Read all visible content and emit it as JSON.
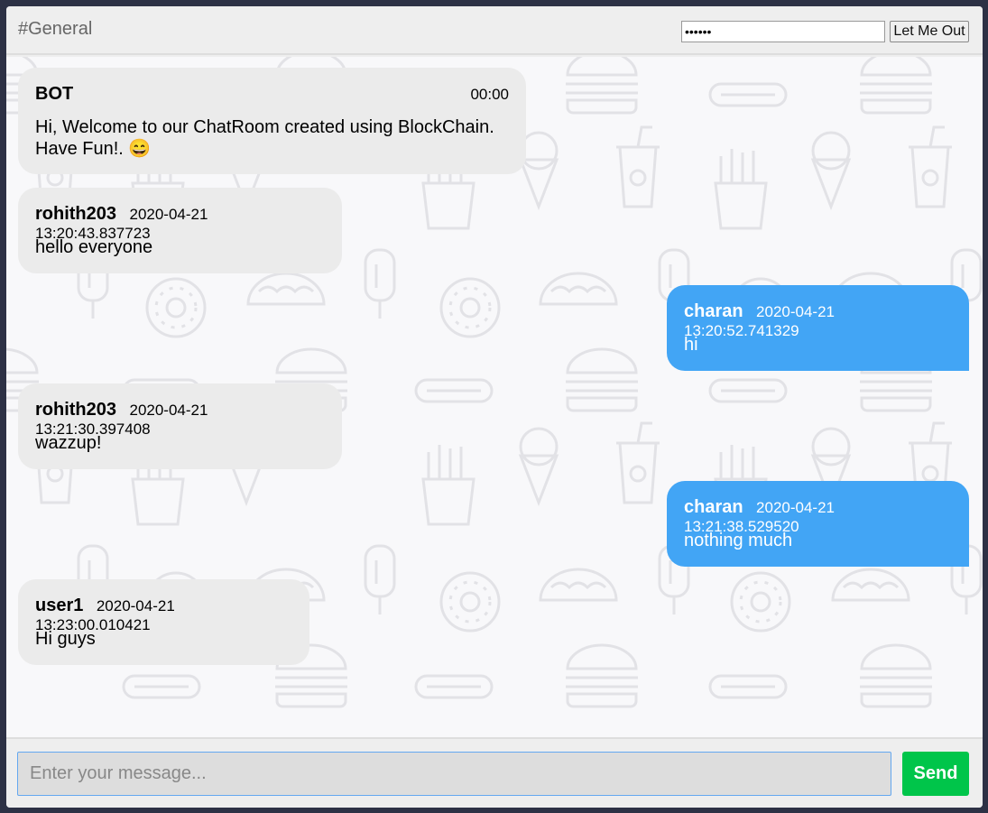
{
  "header": {
    "channel": "#General",
    "password_value": "pass12",
    "logout_label": "Let Me Out"
  },
  "messages": [
    {
      "author": "BOT",
      "time": "00:00",
      "text_line1": "Hi, Welcome to our ChatRoom created using BlockChain.",
      "text_line2": "Have Fun!. 😄",
      "direction": "incoming"
    },
    {
      "author": "rohith203",
      "time": "2020-04-21 13:20:43.837723",
      "text": "hello everyone",
      "direction": "incoming"
    },
    {
      "author": "charan",
      "time": "2020-04-21 13:20:52.741329",
      "text": "hi",
      "direction": "outgoing"
    },
    {
      "author": "rohith203",
      "time": "2020-04-21 13:21:30.397408",
      "text": "wazzup!",
      "direction": "incoming"
    },
    {
      "author": "charan",
      "time": "2020-04-21 13:21:38.529520",
      "text": "nothing much",
      "direction": "outgoing"
    },
    {
      "author": "user1",
      "time": "2020-04-21 13:23:00.010421",
      "text": "Hi guys",
      "direction": "incoming"
    }
  ],
  "composer": {
    "placeholder": "Enter your message...",
    "send_label": "Send"
  },
  "colors": {
    "incoming_bubble": "#ebebeb",
    "outgoing_bubble": "#42a5f5",
    "send_button": "#00c54a"
  },
  "background_icons": [
    "burger-icon",
    "hotdog-icon",
    "fries-icon",
    "ice-cream-icon",
    "soda-cup-icon",
    "donut-icon",
    "taco-icon",
    "popsicle-icon"
  ]
}
